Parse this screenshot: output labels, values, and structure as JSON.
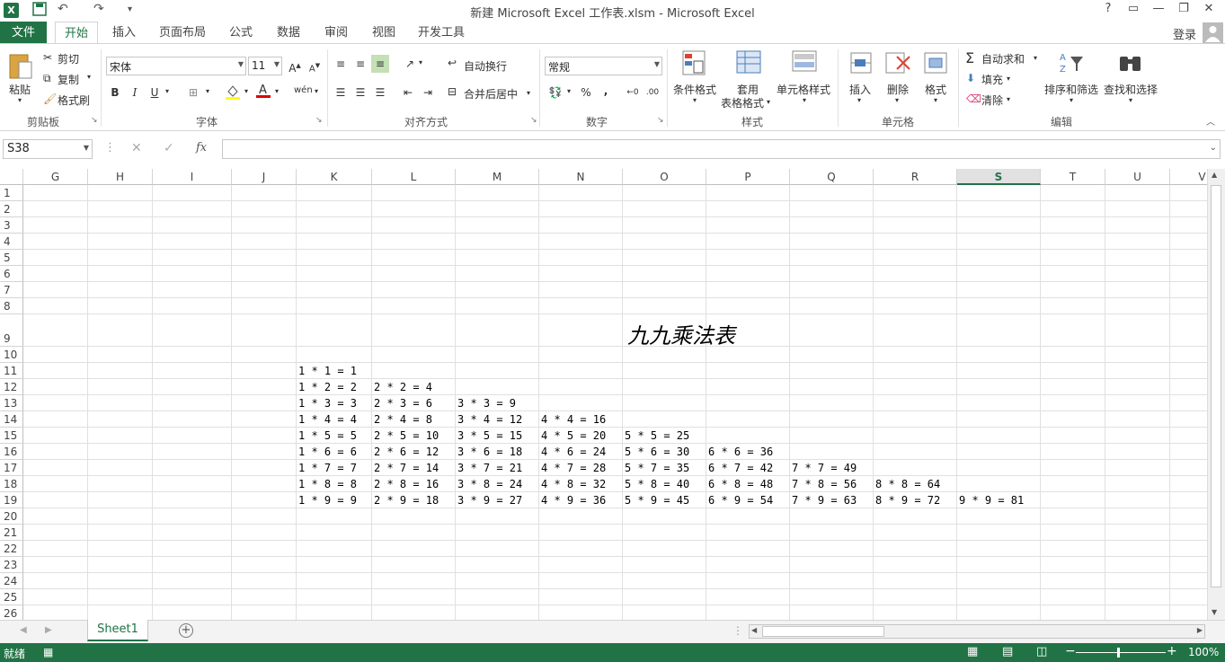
{
  "title_bar": {
    "title": "新建 Microsoft Excel 工作表.xlsm - Microsoft Excel",
    "help": "?",
    "buttons": [
      "restore-ribbon",
      "minimize",
      "maximize",
      "close"
    ]
  },
  "tabs": {
    "file": "文件",
    "items": [
      "开始",
      "插入",
      "页面布局",
      "公式",
      "数据",
      "审阅",
      "视图",
      "开发工具"
    ],
    "active": "开始",
    "login": "登录"
  },
  "ribbon": {
    "clipboard": {
      "paste": "粘贴",
      "cut": "剪切",
      "copy": "复制",
      "format_painter": "格式刷",
      "label": "剪贴板"
    },
    "font": {
      "name": "宋体",
      "size": "11",
      "bold": "B",
      "italic": "I",
      "underline": "U",
      "label": "字体"
    },
    "alignment": {
      "wrap": "自动换行",
      "merge": "合并后居中",
      "label": "对齐方式"
    },
    "number": {
      "format": "常规",
      "percent": "%",
      "comma": ",",
      "label": "数字"
    },
    "styles": {
      "conditional": "条件格式",
      "table_l1": "套用",
      "table_l2": "表格格式",
      "cell_styles": "单元格样式",
      "label": "样式"
    },
    "cells": {
      "insert": "插入",
      "delete": "删除",
      "format": "格式",
      "label": "单元格"
    },
    "editing": {
      "autosum": "自动求和",
      "fill": "填充",
      "clear": "清除",
      "sort": "排序和筛选",
      "find": "查找和选择",
      "label": "编辑"
    }
  },
  "formula_bar": {
    "name_box": "S38",
    "fx": "fx",
    "value": ""
  },
  "grid": {
    "columns": [
      "G",
      "H",
      "I",
      "J",
      "K",
      "L",
      "M",
      "N",
      "O",
      "P",
      "Q",
      "R",
      "S",
      "T",
      "U",
      "V"
    ],
    "selected_column": "S",
    "rows": [
      "1",
      "2",
      "3",
      "4",
      "5",
      "6",
      "7",
      "8",
      "9",
      "10",
      "11",
      "12",
      "13",
      "14",
      "15",
      "16",
      "17",
      "18",
      "19",
      "20",
      "21",
      "22",
      "23",
      "24",
      "25",
      "26"
    ],
    "title_cell": "九九乘法表",
    "table": [
      [
        "1 * 1 = 1"
      ],
      [
        "1 * 2 = 2",
        "2 * 2 = 4"
      ],
      [
        "1 * 3 = 3",
        "2 * 3 = 6",
        "3 * 3 = 9"
      ],
      [
        "1 * 4 = 4",
        "2 * 4 = 8",
        "3 * 4 = 12",
        "4 * 4 = 16"
      ],
      [
        "1 * 5 = 5",
        "2 * 5 = 10",
        "3 * 5 = 15",
        "4 * 5 = 20",
        "5 * 5 = 25"
      ],
      [
        "1 * 6 = 6",
        "2 * 6 = 12",
        "3 * 6 = 18",
        "4 * 6 = 24",
        "5 * 6 = 30",
        "6 * 6 = 36"
      ],
      [
        "1 * 7 = 7",
        "2 * 7 = 14",
        "3 * 7 = 21",
        "4 * 7 = 28",
        "5 * 7 = 35",
        "6 * 7 = 42",
        "7 * 7 = 49"
      ],
      [
        "1 * 8 = 8",
        "2 * 8 = 16",
        "3 * 8 = 24",
        "4 * 8 = 32",
        "5 * 8 = 40",
        "6 * 8 = 48",
        "7 * 8 = 56",
        "8 * 8 = 64"
      ],
      [
        "1 * 9 = 9",
        "2 * 9 = 18",
        "3 * 9 = 27",
        "4 * 9 = 36",
        "5 * 9 = 45",
        "6 * 9 = 54",
        "7 * 9 = 63",
        "8 * 9 = 72",
        "9 * 9 = 81"
      ]
    ]
  },
  "sheets": {
    "active": "Sheet1",
    "add": "+"
  },
  "status": {
    "ready": "就绪",
    "zoom": "100%"
  },
  "colors": {
    "accent": "#217346"
  }
}
